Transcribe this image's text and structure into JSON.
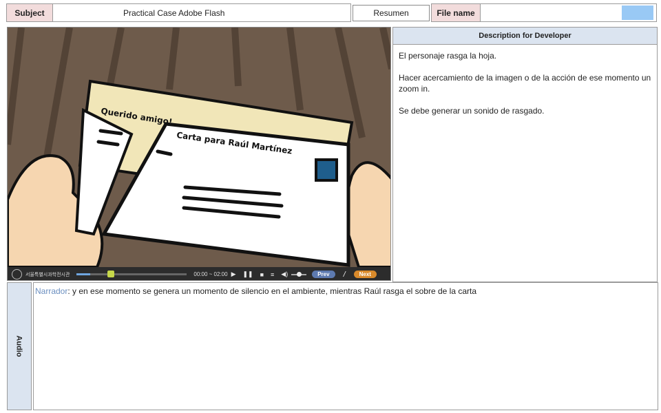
{
  "header": {
    "subject_label": "Subject",
    "subject_value": "Practical Case Adobe Flash",
    "summary_button": "Resumen",
    "filename_label": "File name",
    "filename_value": ""
  },
  "scene": {
    "letter_text": "Querido amigo!",
    "envelope_text": "Carta para Raúl Martínez"
  },
  "player": {
    "institution": "서울특별시과학전시관",
    "time": "00:00 ~ 02:00",
    "prev_label": "Prev",
    "separator": "/",
    "next_label": "Next",
    "progress": 0.12,
    "volume": 0.5
  },
  "description": {
    "title": "Description for Developer",
    "paragraphs": [
      "El personaje rasga la hoja.",
      "Hacer acercamiento de la imagen o de la acción de ese momento un zoom in.",
      "Se debe generar un sonido de rasgado."
    ]
  },
  "audio": {
    "label": "Audio",
    "speaker": "Narrador",
    "line": ": y en ese momento se genera un momento de silencio en el ambiente, mientras Raúl rasga el sobre de la carta"
  },
  "colors": {
    "label_pink": "#f2dcdc",
    "panel_blue": "#dbe4f0",
    "narrator_blue": "#6b8fc0",
    "filename_swatch": "#99c9f5",
    "prev_pill": "#5d7ab0",
    "next_pill": "#d98a2b",
    "stamp": "#1f5e8c"
  }
}
